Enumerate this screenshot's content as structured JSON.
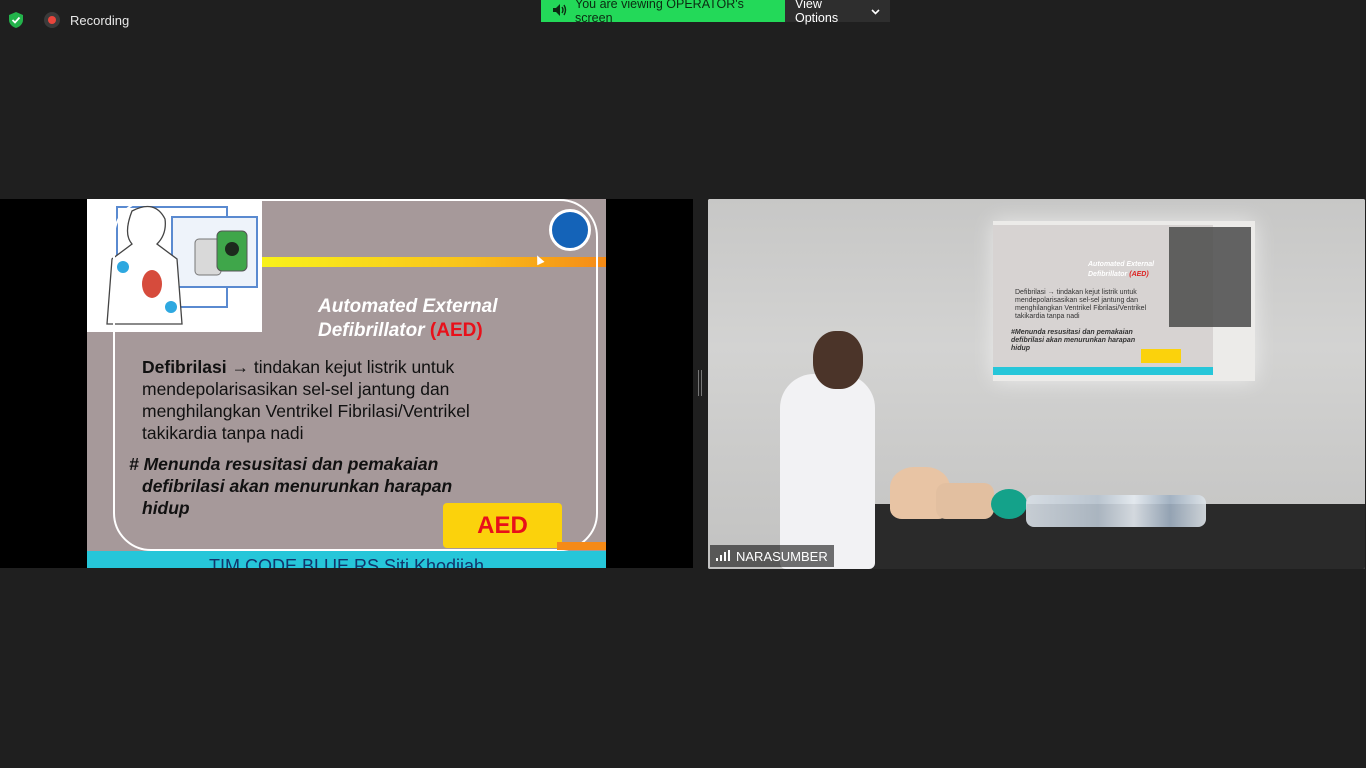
{
  "status": {
    "recording_label": "Recording",
    "shield_icon": "shield-check-icon",
    "recording_icon": "recording-dot-icon"
  },
  "banner": {
    "message": "You are viewing OPERATOR's screen",
    "speaker_icon": "speaker-icon",
    "view_options_label": "View Options",
    "chevron_icon": "chevron-down-icon",
    "accent": "#23d959"
  },
  "shared_slide": {
    "title_line1": "Automated External",
    "title_line2": "Defibrillator",
    "title_abbr": "(AED)",
    "body_term": "Defibrilasi",
    "body_arrow": "→",
    "body_text_line1": "tindakan kejut  listrik untuk",
    "body_text_line2": "mendepolarisasikan sel-sel jantung dan",
    "body_text_line3": "menghilangkan Ventrikel Fibrilasi/Ventrikel",
    "body_text_line4": "takikardia tanpa nadi",
    "hash_line1": "# Menunda resusitasi dan pemakaian",
    "hash_line2": "defibrilasi akan menurunkan harapan",
    "hash_line3": "hidup",
    "aed_badge": "AED",
    "footer": "TIM CODE BLUE RS Siti Khodijah"
  },
  "speaker_video": {
    "name": "NARASUMBER",
    "signal_icon": "signal-bars-icon"
  }
}
